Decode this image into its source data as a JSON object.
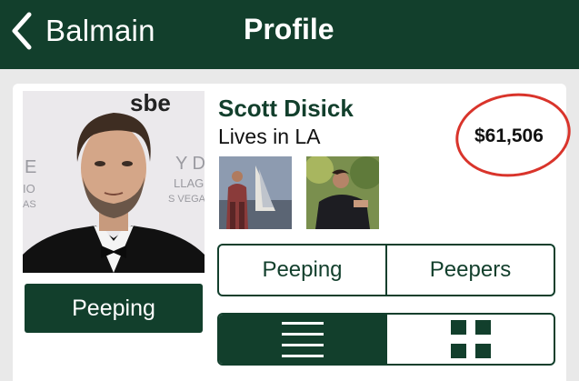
{
  "colors": {
    "brand_green": "#123f2c",
    "highlight_circle": "#d9342b"
  },
  "nav": {
    "back_label": "Balmain",
    "back_icon": "chevron-left-icon",
    "title": "Profile"
  },
  "profile": {
    "name": "Scott Disick",
    "location": "Lives in LA",
    "value": "$61,506",
    "follow_label": "Peeping",
    "photo_sign_text": "sbe"
  },
  "segments": [
    {
      "label": "Peeping"
    },
    {
      "label": "Peepers"
    }
  ],
  "view_toggle": {
    "list_icon": "list-icon",
    "grid_icon": "grid-icon",
    "active": "list"
  }
}
